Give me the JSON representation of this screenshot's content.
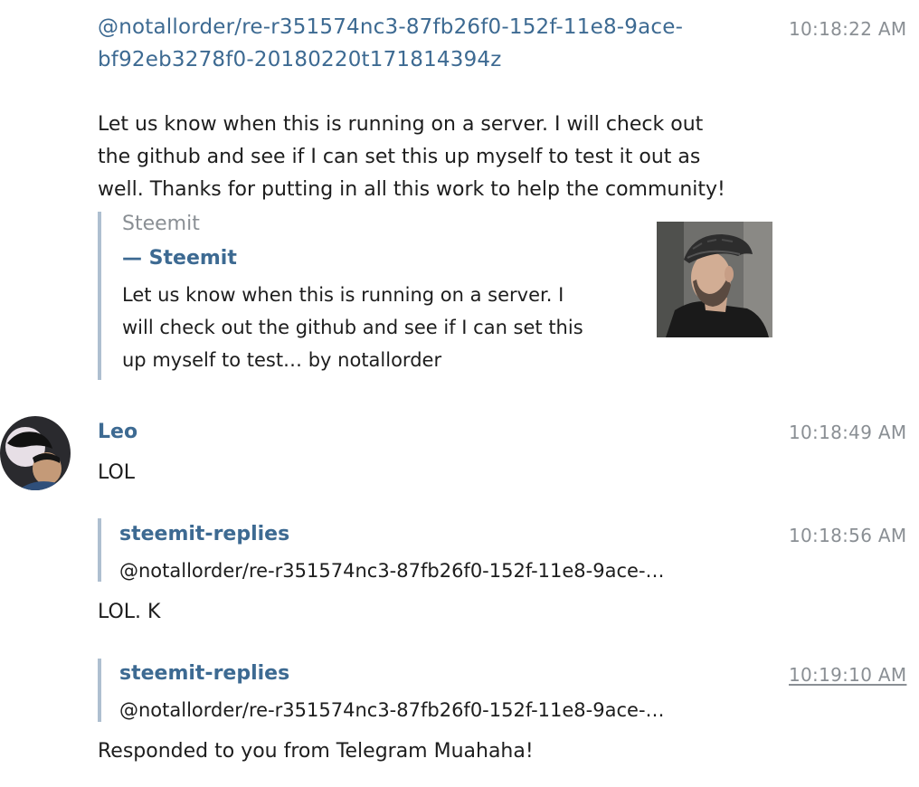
{
  "messages": [
    {
      "link_text": "@notallorder/re-r351574nc3-87fb26f0-152f-11e8-9ace-bf92eb3278f0-20180220t171814394z",
      "link_line1": "@notallorder/re-r351574nc3-87fb26f0-152f-11e8-9ace-",
      "link_line2": "bf92eb3278f0-20180220t171814394z",
      "time": "10:18:22 AM",
      "body_line1": "Let us know when this is running on a server. I will check out",
      "body_line2": "the github and see if I can set this up myself to test it out as",
      "body_line3": "well. Thanks for putting in all this work to help the community!",
      "preview": {
        "site": "Steemit",
        "author": "— Steemit",
        "desc_line1": "Let us know when this is running on a server. I",
        "desc_line2": "will check out the github and see if I can set this",
        "desc_line3": "up myself to test… by notallorder"
      }
    },
    {
      "sender": "Leo",
      "time": "10:18:49 AM",
      "text": "LOL"
    },
    {
      "reply_to": "steemit-replies",
      "reply_snippet": "@notallorder/re-r351574nc3-87fb26f0-152f-11e8-9ace-…",
      "time": "10:18:56 AM",
      "text": "LOL. K"
    },
    {
      "reply_to": "steemit-replies",
      "reply_snippet": "@notallorder/re-r351574nc3-87fb26f0-152f-11e8-9ace-…",
      "time": "10:19:10 AM",
      "text": "Responded to you from Telegram Muahaha!"
    }
  ],
  "colors": {
    "link": "#3d6a92",
    "timestamp": "#8a8f94",
    "quote_bar": "#aebfd0"
  }
}
